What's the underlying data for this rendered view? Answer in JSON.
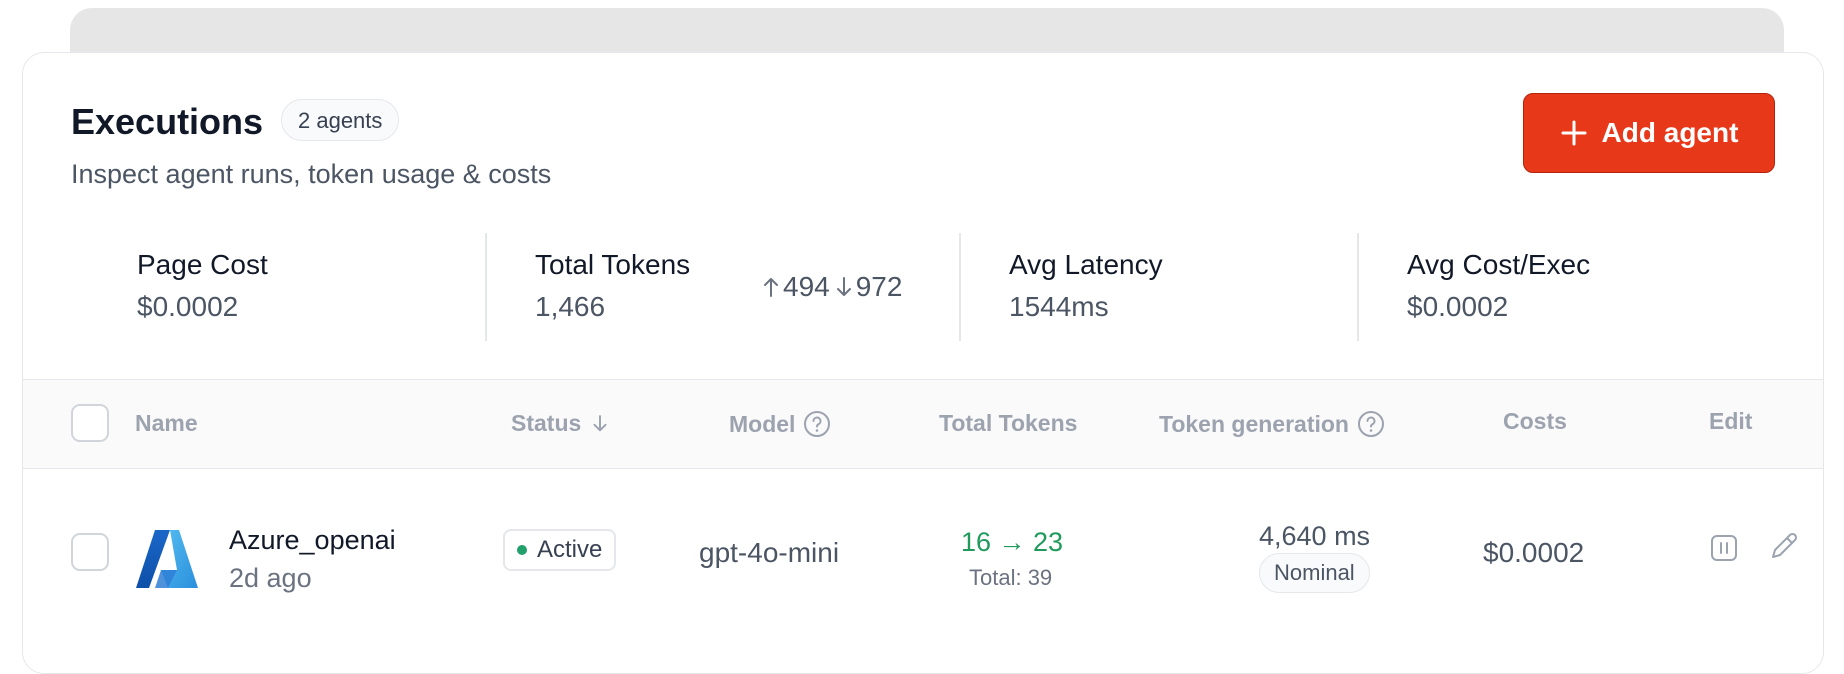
{
  "header": {
    "title": "Executions",
    "agents_badge": "2 agents",
    "subtitle": "Inspect agent runs, token usage & costs",
    "add_button_label": "Add agent",
    "add_button_icon": "plus-icon"
  },
  "stats": {
    "page_cost": {
      "label": "Page Cost",
      "value": "$0.0002"
    },
    "total_tokens": {
      "label": "Total Tokens",
      "value": "1,466",
      "input": "494",
      "output": "972"
    },
    "avg_latency": {
      "label": "Avg Latency",
      "value": "1544ms"
    },
    "avg_cost": {
      "label": "Avg Cost/Exec",
      "value": "$0.0002"
    }
  },
  "table": {
    "columns": {
      "name": "Name",
      "status": "Status",
      "model": "Model",
      "total_tokens": "Total Tokens",
      "token_generation": "Token generation",
      "costs": "Costs",
      "edit": "Edit"
    },
    "rows": [
      {
        "name": "Azure_openai",
        "time": "2d ago",
        "status": "Active",
        "model": "gpt-4o-mini",
        "tokens": "16 → 23",
        "tokens_total": "Total: 39",
        "generation_ms": "4,640 ms",
        "generation_badge": "Nominal",
        "cost": "$0.0002"
      }
    ]
  },
  "colors": {
    "accent": "#e8381a",
    "success": "#1f9a5b",
    "status_dot": "#22a06b"
  }
}
